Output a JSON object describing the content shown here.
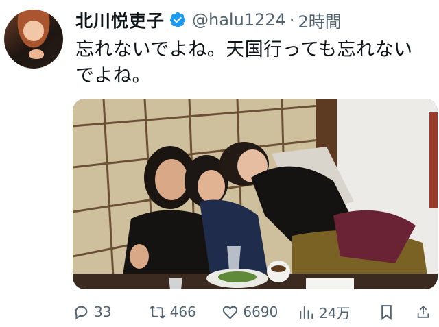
{
  "tweet": {
    "author_name": "北川悦吏子",
    "handle": "@halu1224",
    "separator": "·",
    "time": "2時間",
    "text_line1": "忘れないでよね。天国行っても忘れない",
    "text_line2": "でよね。"
  },
  "icons": {
    "verified": "verified-badge-icon",
    "reply": "reply-icon",
    "retweet": "retweet-icon",
    "like": "heart-icon",
    "views": "views-icon",
    "bookmark": "bookmark-icon",
    "share": "share-icon"
  },
  "actions": {
    "replies": "33",
    "retweets": "466",
    "likes": "6690",
    "views": "24万"
  },
  "colors": {
    "text": "#0f1419",
    "secondary": "#536471",
    "verified": "#1d9bf0"
  }
}
